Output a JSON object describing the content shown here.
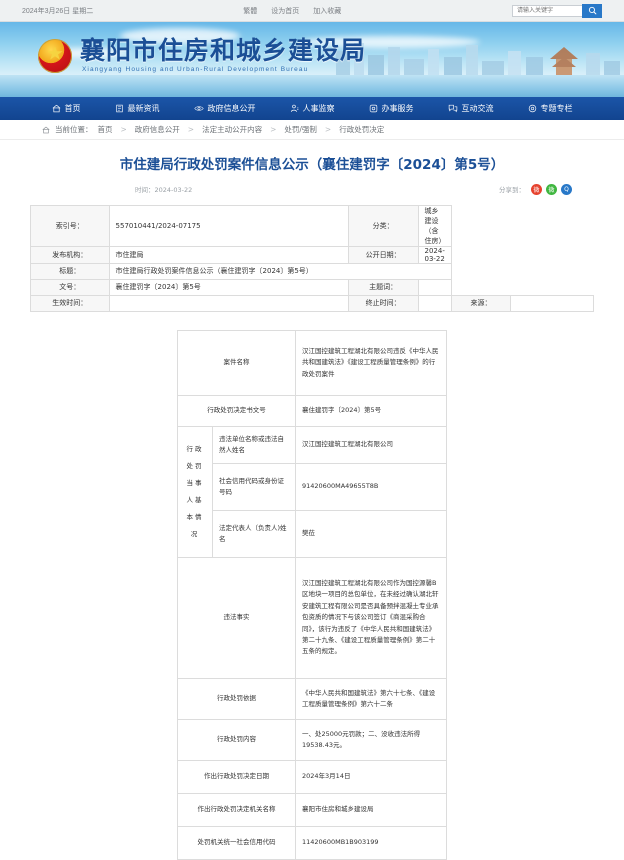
{
  "topbar": {
    "date": "2024年3月26日 星期二",
    "links": [
      "繁體",
      "设为首页",
      "加入收藏"
    ],
    "search_placeholder": "请输入关键字",
    "search_value": "",
    "search_icon": "search-icon"
  },
  "banner": {
    "title_cn": "襄阳市住房和城乡建设局",
    "title_en": "Xiangyang Housing and Urban-Rural Development Bureau",
    "emblem": "national-emblem-icon"
  },
  "nav": [
    {
      "label": "首页",
      "icon": "home-icon"
    },
    {
      "label": "最新资讯",
      "icon": "news-icon"
    },
    {
      "label": "政府信息公开",
      "icon": "eye-icon"
    },
    {
      "label": "人事监察",
      "icon": "person-icon"
    },
    {
      "label": "办事服务",
      "icon": "service-icon"
    },
    {
      "label": "互动交流",
      "icon": "chat-icon"
    },
    {
      "label": "专题专栏",
      "icon": "target-icon"
    }
  ],
  "breadcrumb": {
    "icon": "home-icon",
    "label": "当前位置：",
    "items": [
      "首页",
      "政府信息公开",
      "法定主动公开内容",
      "处罚/强制",
      "行政处罚决定"
    ],
    "separator": ">"
  },
  "article": {
    "title": "市住建局行政处罚案件信息公示（襄住建罚字〔2024〕第5号）",
    "time": "时间：2024-03-22",
    "share_label": "分享到：",
    "share_icons": [
      {
        "name": "weibo-share-icon",
        "glyph": "微",
        "color": "#e6422e"
      },
      {
        "name": "wechat-share-icon",
        "glyph": "微",
        "color": "#3fb63f"
      },
      {
        "name": "qq-share-icon",
        "glyph": "Q",
        "color": "#2878c8"
      }
    ]
  },
  "info_table": {
    "rows": [
      [
        {
          "k": "索引号：",
          "v": "557010441/2024-07175"
        },
        {
          "k": "分类：",
          "v": "城乡建设（含住房）"
        }
      ],
      [
        {
          "k": "发布机构：",
          "v": "市住建局"
        },
        {
          "k": "公开日期：",
          "v": "2024-03-22"
        }
      ]
    ],
    "title_row": {
      "k": "标题：",
      "v": "市住建局行政处罚案件信息公示（襄住建罚字〔2024〕第5号）"
    },
    "row3": [
      {
        "k": "文号：",
        "v": "襄住建罚字〔2024〕第5号"
      },
      {
        "k": "主题词：",
        "v": ""
      }
    ],
    "row4": [
      {
        "k": "生效时间：",
        "v": ""
      },
      {
        "k": "终止时间：",
        "v": ""
      },
      {
        "k": "来源：",
        "v": ""
      }
    ]
  },
  "content_table": {
    "case_name_label": "案件名称",
    "case_name_value": "汉江国控建筑工程湖北有限公司违反《中华人民共和国建筑法》《建设工程质量管理条例》的行政处罚案件",
    "doc_no_label": "行政处罚决定书文号",
    "doc_no_value": "襄住建罚字〔2024〕第5号",
    "party_group_label": "行政处罚当事人基本情况",
    "party_rows": [
      {
        "label": "违法单位名称或违法自然人姓名",
        "value": "汉江国控建筑工程湖北有限公司"
      },
      {
        "label": "社会信用代码或身份证号码",
        "value": "91420600MA49655T8B"
      },
      {
        "label": "法定代表人（负责人)姓名",
        "value": "樊莅"
      }
    ],
    "facts_label": "违法事实",
    "facts_value": "汉江国控建筑工程湖北有限公司作为国控源馨B区地块一项目的总包单位，在未经过确认湖北轩安建筑工程有限公司是否具备预拌混凝土专业承包资质的情况下与该公司签订《商混采购合同》，该行为违反了《中华人民共和国建筑法》第二十九条、《建设工程质量管理条例》第二十五条的规定。",
    "basis_label": "行政处罚依据",
    "basis_value": "《中华人民共和国建筑法》第六十七条、《建设工程质量管理条例》第六十二条",
    "penalty_label": "行政处罚内容",
    "penalty_value": "一、处25000元罚款；二、没收违法所得19538.43元。",
    "date_label": "作出行政处罚决定日期",
    "date_value": "2024年3月14日",
    "organ_label": "作出行政处罚决定机关名称",
    "organ_value": "襄阳市住房和城乡建设局",
    "organ_code_label": "处罚机关统一社会信用代码",
    "organ_code_value": "11420600MB1B903199"
  }
}
